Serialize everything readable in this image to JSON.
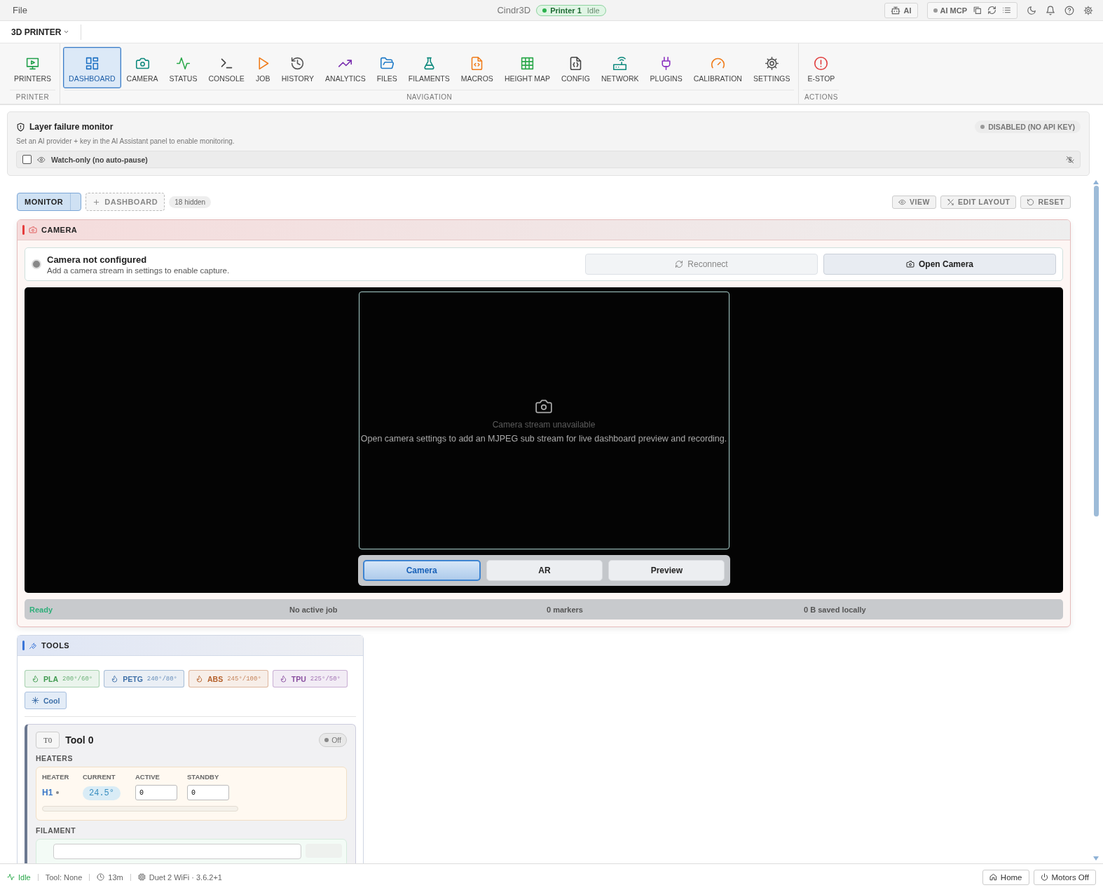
{
  "topbar": {
    "menu": "File",
    "app_title": "Cindr3D",
    "printer": {
      "name": "Printer 1",
      "status": "Idle"
    },
    "ai_button": "AI",
    "mcp_label": "AI MCP"
  },
  "printer_selector": "3D PRINTER",
  "ribbon": {
    "groups": [
      {
        "label": "PRINTER",
        "items": [
          {
            "label": "PRINTERS",
            "kind": "printers",
            "color": "#22a04b",
            "selected": false
          }
        ]
      },
      {
        "label": "NAVIGATION",
        "items": [
          {
            "label": "DASHBOARD",
            "kind": "dashboard",
            "color": "#1f72c4",
            "selected": true
          },
          {
            "label": "CAMERA",
            "kind": "camera",
            "color": "#0f8a7e",
            "selected": false
          },
          {
            "label": "STATUS",
            "kind": "status",
            "color": "#2aa84a",
            "selected": false
          },
          {
            "label": "CONSOLE",
            "kind": "console",
            "color": "#444444",
            "selected": false
          },
          {
            "label": "JOB",
            "kind": "job",
            "color": "#f07c1a",
            "selected": false
          },
          {
            "label": "HISTORY",
            "kind": "history",
            "color": "#555555",
            "selected": false
          },
          {
            "label": "ANALYTICS",
            "kind": "analytics",
            "color": "#7a2fb0",
            "selected": false
          },
          {
            "label": "FILES",
            "kind": "files",
            "color": "#1e7ac8",
            "selected": false
          },
          {
            "label": "FILAMENTS",
            "kind": "filaments",
            "color": "#0f8a7e",
            "selected": false
          },
          {
            "label": "MACROS",
            "kind": "macros",
            "color": "#f07c1a",
            "selected": false
          },
          {
            "label": "HEIGHT MAP",
            "kind": "heightmap",
            "color": "#2aa84a",
            "selected": false
          },
          {
            "label": "CONFIG",
            "kind": "config",
            "color": "#444444",
            "selected": false
          },
          {
            "label": "NETWORK",
            "kind": "network",
            "color": "#0f8a7e",
            "selected": false
          },
          {
            "label": "PLUGINS",
            "kind": "plugins",
            "color": "#8a2fc0",
            "selected": false
          },
          {
            "label": "CALIBRATION",
            "kind": "calibration",
            "color": "#f07c1a",
            "selected": false
          },
          {
            "label": "SETTINGS",
            "kind": "settings",
            "color": "#555555",
            "selected": false
          }
        ]
      },
      {
        "label": "ACTIONS",
        "items": [
          {
            "label": "E-STOP",
            "kind": "estop",
            "color": "#e03b3b",
            "selected": false
          }
        ]
      }
    ]
  },
  "monitor": {
    "title": "Layer failure monitor",
    "status": "DISABLED (NO API KEY)",
    "hint": "Set an AI provider + key in the AI Assistant panel to enable monitoring.",
    "watch": {
      "label": "Watch-only (no auto-pause)",
      "checked": false
    }
  },
  "dashboard": {
    "tabs": [
      {
        "label": "MONITOR",
        "selected": true
      }
    ],
    "add_label": "DASHBOARD",
    "hidden_count": "18 hidden",
    "actions": [
      "VIEW",
      "EDIT LAYOUT",
      "RESET"
    ]
  },
  "camera": {
    "title": "CAMERA",
    "notice": {
      "title": "Camera not configured",
      "text": "Add a camera stream in settings to enable capture."
    },
    "buttons": [
      {
        "label": "Reconnect",
        "disabled": true
      },
      {
        "label": "Open Camera",
        "disabled": false
      }
    ],
    "placeholder": {
      "title": "Camera stream unavailable",
      "text": "Open camera settings to add an MJPEG sub stream for live dashboard preview and recording."
    },
    "modes": [
      {
        "label": "Camera",
        "selected": true
      },
      {
        "label": "AR",
        "selected": false
      },
      {
        "label": "Preview",
        "selected": false
      }
    ],
    "status": "Ready",
    "stats": [
      "No active job",
      "0 markers",
      "0 B saved locally"
    ]
  },
  "tools": {
    "title": "TOOLS",
    "presets": [
      {
        "name": "PLA",
        "temps": "200°/60°",
        "color": "#3f9a4f"
      },
      {
        "name": "PETG",
        "temps": "240°/80°",
        "color": "#3d6fa8"
      },
      {
        "name": "ABS",
        "temps": "245°/100°",
        "color": "#b5602a"
      },
      {
        "name": "TPU",
        "temps": "225°/50°",
        "color": "#8a4fa0"
      }
    ],
    "cool": "Cool",
    "tool": {
      "badge": "T0",
      "name": "Tool 0",
      "power": {
        "label": "Off",
        "on": false
      },
      "heaters_label": "HEATERS",
      "columns": [
        "HEATER",
        "CURRENT",
        "ACTIVE",
        "STANDBY"
      ],
      "heaters": [
        {
          "name": "H1",
          "current": "24.5°",
          "active": "0",
          "standby": "0",
          "level": 0
        }
      ],
      "filament_label": "FILAMENT"
    }
  },
  "statusbar": {
    "state": "Idle",
    "tool": "Tool: None",
    "uptime": "13m",
    "board": "Duet 2 WiFi · 3.6.2+1",
    "buttons": [
      "Home",
      "Motors Off"
    ]
  }
}
